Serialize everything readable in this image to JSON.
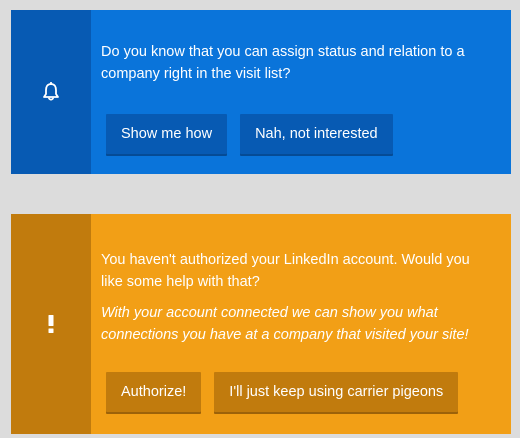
{
  "notifications": [
    {
      "icon": "bell-icon",
      "message": "Do you know that you can assign status and relation to a company right in the visit list?",
      "buttons": [
        "Show me how",
        "Nah, not interested"
      ]
    },
    {
      "icon": "exclamation-icon",
      "message": "You haven't authorized your LinkedIn account. Would you like some help with that?",
      "submessage": "With your account connected we can show you what connections you have at a company that visited your site!",
      "buttons": [
        "Authorize!",
        "I'll just keep using carrier pigeons"
      ]
    }
  ],
  "colors": {
    "page_background": "#dcdcdc",
    "info_background": "#0a74da",
    "info_dark": "#075ab3",
    "warning_background": "#f29f16",
    "warning_dark": "#c17b0d"
  }
}
